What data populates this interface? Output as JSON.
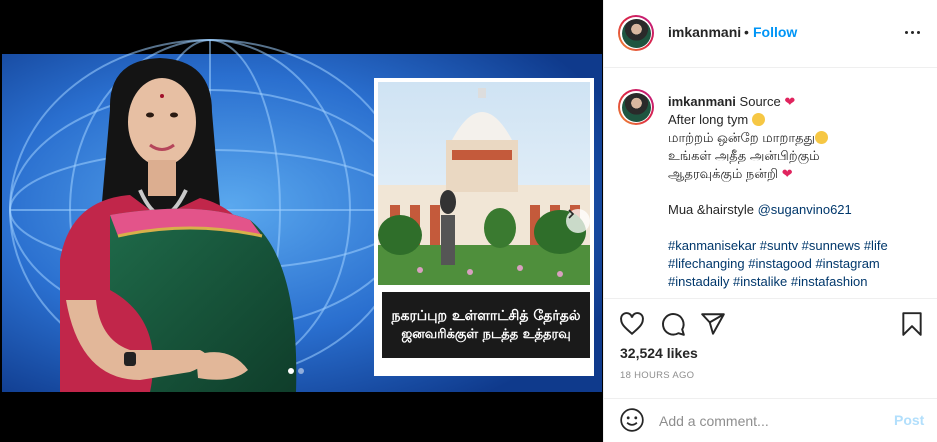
{
  "post": {
    "media": {
      "news_caption_line1": "நகரப்புற உள்ளாட்சித் தேர்தல்",
      "news_caption_line2": "ஜனவரிக்குள் நடத்த உத்தரவு",
      "carousel_dots": 2,
      "carousel_active_index": 0
    },
    "header": {
      "username": "imkanmani",
      "separator": "•",
      "follow_label": "Follow"
    },
    "caption": {
      "username": "imkanmani",
      "line1_text": "Source",
      "line2_text": "After long tym",
      "line3_text": "மாற்றம் ஒன்றே மாறாதது",
      "line4_text": "உங்கள் அதீத அன்பிற்கும்",
      "line5_text": "ஆதரவுக்கும் நன்றி",
      "credit_prefix": "Mua &hairstyle",
      "credit_mention": "@suganvino621",
      "hashtags_line1": "#kanmanisekar #suntv #sunnews #life",
      "hashtags_line2": "#lifechanging #instagood #instagram",
      "hashtags_line3": "#instadaily #instalike #instafashion"
    },
    "actions": {
      "icons": [
        "heart-icon",
        "comment-icon",
        "share-icon",
        "bookmark-icon"
      ]
    },
    "likes_text": "32,524 likes",
    "timestamp": "18 HOURS AGO",
    "comment_box": {
      "placeholder": "Add a comment...",
      "post_label": "Post"
    },
    "colors": {
      "follow_blue": "#0095f6",
      "link_blue": "#00376b",
      "post_disabled": "#b2dffc",
      "heart_red": "#e0245e"
    }
  }
}
